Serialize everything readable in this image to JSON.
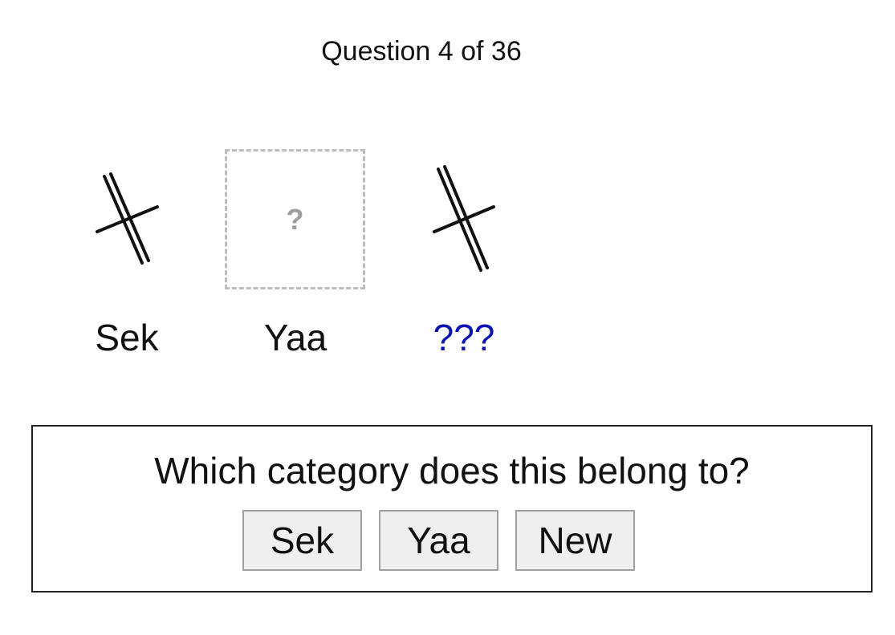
{
  "header": {
    "progress_text": "Question 4 of 36"
  },
  "stimuli": [
    {
      "label": "Sek",
      "icon": "crossed-double-line-glyph",
      "shown": true
    },
    {
      "label": "Yaa",
      "icon": "question-placeholder",
      "placeholder_mark": "?",
      "shown": false
    },
    {
      "label": "???",
      "icon": "crossed-double-line-glyph",
      "shown": true
    }
  ],
  "question": {
    "prompt": "Which category does this belong to?",
    "options": [
      {
        "label": "Sek"
      },
      {
        "label": "Yaa"
      },
      {
        "label": "New"
      }
    ]
  },
  "colors": {
    "unknown_label": "#0a14b3",
    "placeholder_border": "#bdbdbd",
    "button_bg": "#efefef"
  }
}
